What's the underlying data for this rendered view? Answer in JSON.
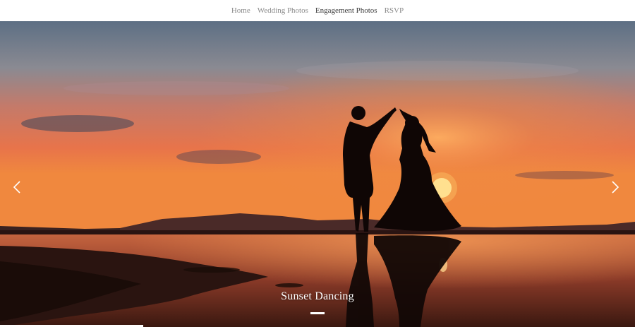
{
  "nav": {
    "items": [
      {
        "label": "Home",
        "active": false
      },
      {
        "label": "Wedding Photos",
        "active": false
      },
      {
        "label": "Engagement Photos",
        "active": true
      },
      {
        "label": "RSVP",
        "active": false
      }
    ]
  },
  "carousel": {
    "caption": "Sunset Dancing",
    "slide_count": 1,
    "active_slide": 0,
    "progress_fraction": 0.225,
    "prev_icon": "chevron-left-icon",
    "next_icon": "chevron-right-icon"
  },
  "colors": {
    "nav_text": "#8a8a8a",
    "nav_active": "#3a3a3a",
    "sky_top": "#5d6f84",
    "sky_glow": "#f07a3a",
    "sun": "#ffe8a0",
    "silhouette": "#0f0605"
  }
}
